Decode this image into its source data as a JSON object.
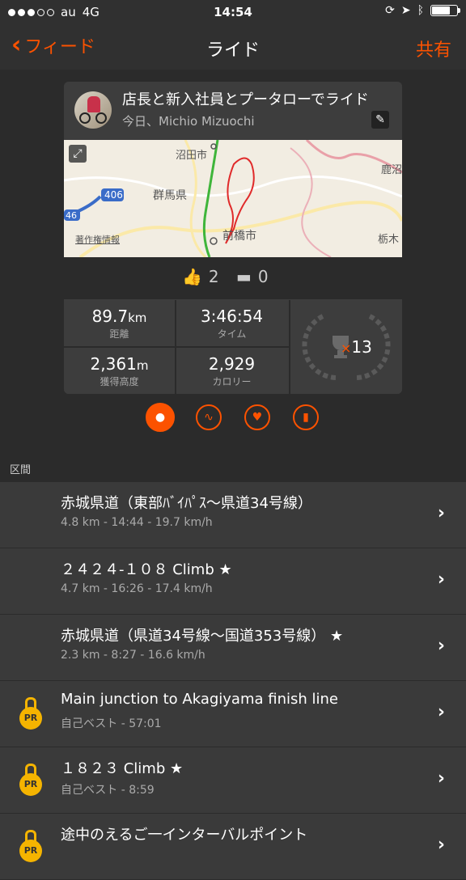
{
  "status": {
    "carrier": "au",
    "network": "4G",
    "time": "14:54"
  },
  "nav": {
    "back_label": "フィード",
    "title": "ライド",
    "share_label": "共有"
  },
  "activity": {
    "title": "店長と新入社員とプータローでライド",
    "subtitle": "今日、Michio Mizuochi",
    "map_labels": {
      "numata": "沼田市",
      "gunma": "群馬県",
      "maebashi": "前橋市",
      "copyright": "著作権情報",
      "route406": "406",
      "route46": "46",
      "kano": "鹿沼",
      "tochigi": "栃木"
    },
    "kudos_count": "2",
    "comment_count": "0",
    "stats": {
      "distance_value": "89.7",
      "distance_unit": "km",
      "distance_label": "距離",
      "time_value": "3:46:54",
      "time_label": "タイム",
      "elevation_value": "2,361",
      "elevation_unit": "m",
      "elevation_label": "獲得高度",
      "calories_value": "2,929",
      "calories_label": "カロリー",
      "achievements": "13"
    }
  },
  "section_label": "区間",
  "segments": [
    {
      "name": "赤城県道（東部ﾊﾞｲﾊﾟｽ〜県道34号線）",
      "meta": "4.8 km - 14:44 - 19.7 km/h",
      "pr": false
    },
    {
      "name": "２４２４-１０８ Climb ★",
      "meta": "4.7 km - 16:26 - 17.4 km/h",
      "pr": false
    },
    {
      "name": "赤城県道（県道34号線〜国道353号線） ★",
      "meta": "2.3 km - 8:27 - 16.6 km/h",
      "pr": false
    },
    {
      "name": "Main junction to Akagiyama finish line",
      "meta": "自己ベスト - 57:01",
      "pr": true
    },
    {
      "name": "１８２３ Climb ★",
      "meta": "自己ベスト - 8:59",
      "pr": true
    },
    {
      "name": "途中のえるご一インターバルポイント",
      "meta": "",
      "pr": true
    }
  ],
  "pr_badge": "PR",
  "colors": {
    "accent": "#fc5200",
    "background": "#2b2b2b",
    "row": "#3a3a3a",
    "pr_gold": "#f5b400"
  }
}
